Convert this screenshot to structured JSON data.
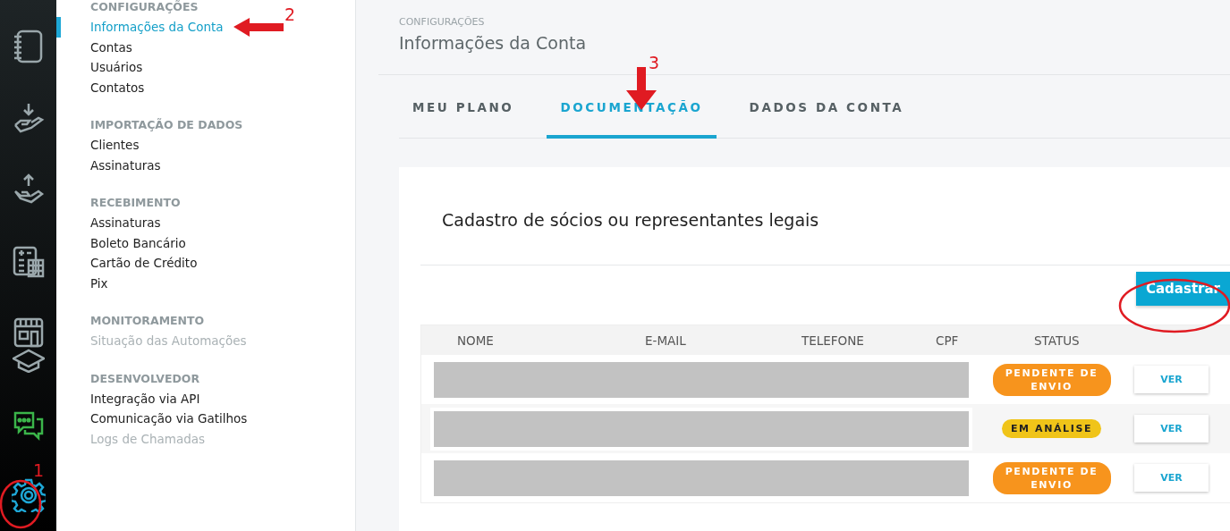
{
  "rail": [
    {
      "kind": "notebook",
      "selected": false
    },
    {
      "kind": "receive",
      "selected": false
    },
    {
      "kind": "send",
      "selected": false
    },
    {
      "kind": "calculator",
      "selected": false
    },
    {
      "kind": "store",
      "selected": false
    },
    {
      "kind": "chat",
      "selected": false
    },
    {
      "kind": "settings",
      "selected": true
    }
  ],
  "sidebar": {
    "sections": [
      {
        "title": "CONFIGURAÇÕES",
        "items": [
          {
            "label": "Informações da Conta",
            "selected": true,
            "disabled": false
          },
          {
            "label": "Contas",
            "selected": false,
            "disabled": false
          },
          {
            "label": "Usuários",
            "selected": false,
            "disabled": false
          },
          {
            "label": "Contatos",
            "selected": false,
            "disabled": false
          }
        ]
      },
      {
        "title": "IMPORTAÇÃO DE DADOS",
        "items": [
          {
            "label": "Clientes",
            "selected": false,
            "disabled": false
          },
          {
            "label": "Assinaturas",
            "selected": false,
            "disabled": false
          }
        ]
      },
      {
        "title": "RECEBIMENTO",
        "items": [
          {
            "label": "Assinaturas",
            "selected": false,
            "disabled": false
          },
          {
            "label": "Boleto Bancário",
            "selected": false,
            "disabled": false
          },
          {
            "label": "Cartão de Crédito",
            "selected": false,
            "disabled": false
          },
          {
            "label": "Pix",
            "selected": false,
            "disabled": false
          }
        ]
      },
      {
        "title": "MONITORAMENTO",
        "items": [
          {
            "label": "Situação das Automações",
            "selected": false,
            "disabled": true
          }
        ]
      },
      {
        "title": "DESENVOLVEDOR",
        "items": [
          {
            "label": "Integração via API",
            "selected": false,
            "disabled": false
          },
          {
            "label": "Comunicação via Gatilhos",
            "selected": false,
            "disabled": false
          },
          {
            "label": "Logs de Chamadas",
            "selected": false,
            "disabled": true
          }
        ]
      }
    ]
  },
  "header": {
    "breadcrumb": "CONFIGURAÇÕES",
    "title": "Informações da Conta"
  },
  "tabs": [
    {
      "label": "MEU PLANO",
      "selected": false
    },
    {
      "label": "DOCUMENTAÇÃO",
      "selected": true
    },
    {
      "label": "DADOS DA CONTA",
      "selected": false
    }
  ],
  "card": {
    "title": "Cadastro de sócios ou representantes legais",
    "button": "Cadastrar",
    "table": {
      "columns": [
        "NOME",
        "E-MAIL",
        "TELEFONE",
        "CPF",
        "STATUS"
      ],
      "rows": [
        {
          "status": "PENDENTE DE ENVIO",
          "color": "#f7941d",
          "action": "VER"
        },
        {
          "status": "EM ANÁLISE",
          "color": "#f0c419",
          "action": "VER"
        },
        {
          "status": "PENDENTE DE ENVIO",
          "color": "#f7941d",
          "action": "VER"
        }
      ]
    }
  },
  "annotations": [
    {
      "number": "1"
    },
    {
      "number": "2"
    },
    {
      "number": "3"
    }
  ]
}
